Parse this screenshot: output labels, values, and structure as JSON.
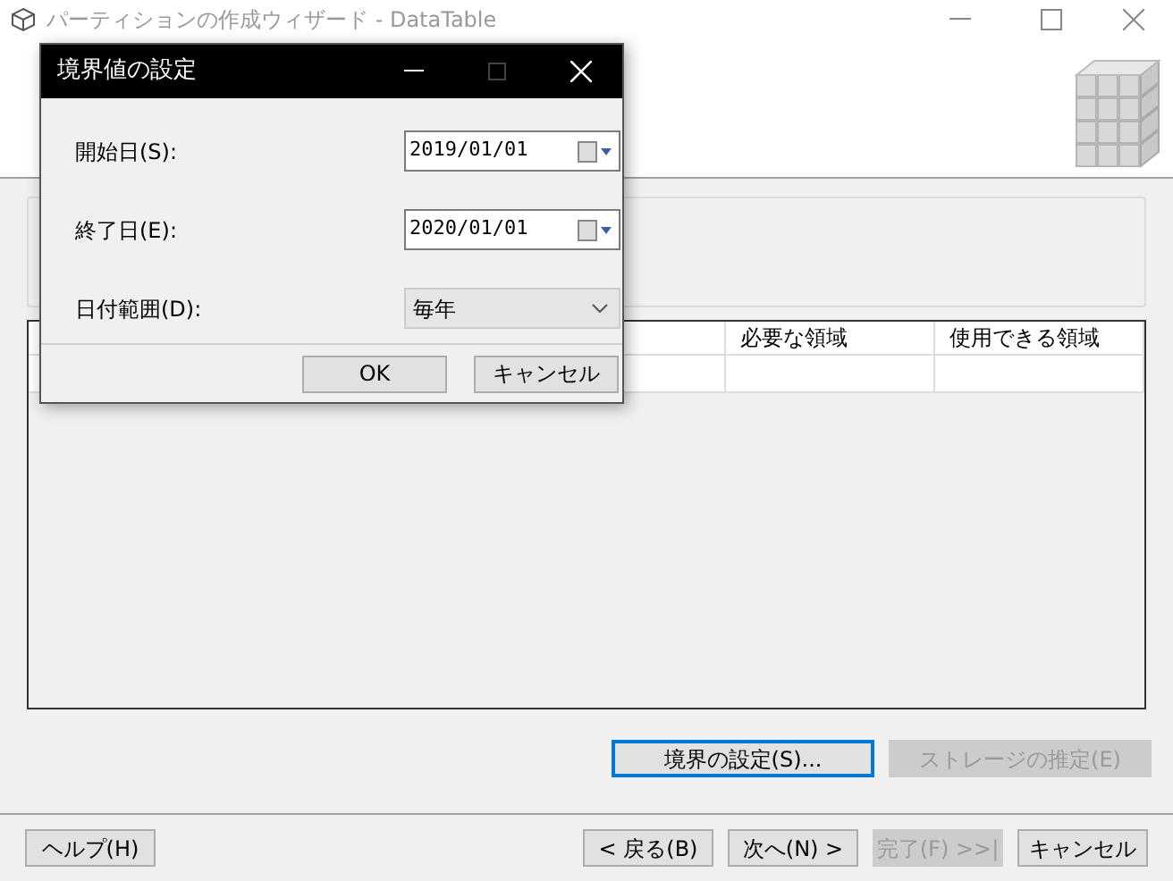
{
  "window": {
    "title": "パーティションの作成ウィザード - DataTable"
  },
  "table": {
    "columns": [
      "必要な領域",
      "使用できる領域"
    ]
  },
  "actions": [
    {
      "label": "境界の設定(S)...",
      "focused": true,
      "disabled": false
    },
    {
      "label": "ストレージの推定(E)",
      "focused": false,
      "disabled": true
    }
  ],
  "footer_buttons": [
    {
      "label": "ヘルプ(H)",
      "disabled": false
    },
    {
      "label": "< 戻る(B)",
      "disabled": false
    },
    {
      "label": "次へ(N) >",
      "disabled": false
    },
    {
      "label": "完了(F) >>|",
      "disabled": true
    },
    {
      "label": "キャンセル",
      "disabled": false
    }
  ],
  "dialog": {
    "title": "境界値の設定",
    "fields": [
      {
        "kind": "date",
        "label": "開始日(S):",
        "value": "2019/01/01"
      },
      {
        "kind": "date",
        "label": "終了日(E):",
        "value": "2020/01/01"
      },
      {
        "kind": "combo",
        "label": "日付範囲(D):",
        "value": "毎年"
      }
    ],
    "buttons": [
      "OK",
      "キャンセル"
    ]
  }
}
